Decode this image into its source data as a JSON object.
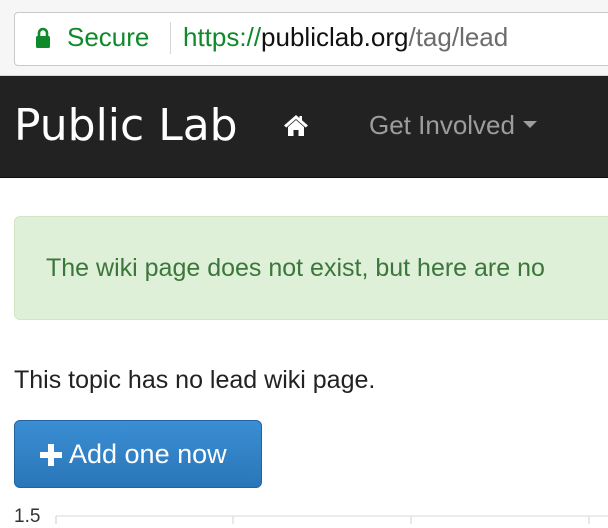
{
  "browser": {
    "secure_label": "Secure",
    "url_scheme": "https://",
    "url_host": "publiclab.org",
    "url_path": "/tag/lead",
    "secure_color": "#0f8a2b"
  },
  "navbar": {
    "brand": "Public Lab",
    "home_icon": "home-icon",
    "get_involved": "Get Involved"
  },
  "alert": {
    "text": "The wiki page does not exist, but here are no"
  },
  "main": {
    "notice": "This topic has no lead wiki page.",
    "add_button_label": "Add one now",
    "add_button_icon": "plus-icon",
    "button_color": "#2b7cc1"
  },
  "chart_data": {
    "type": "line",
    "y_ticks": [
      "1.5"
    ]
  }
}
